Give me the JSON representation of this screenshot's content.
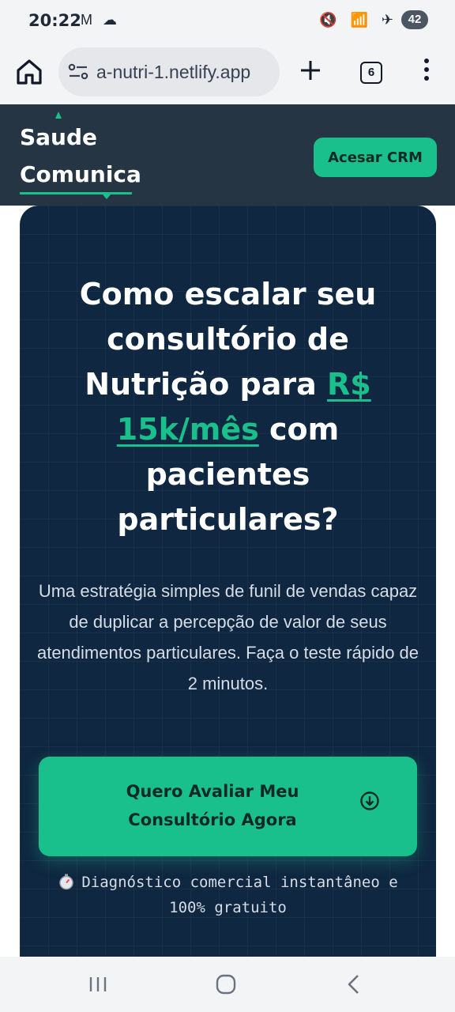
{
  "status_bar": {
    "time": "20:22",
    "left_icons": "M ☁",
    "right_icons": "🔇 📶 ✈",
    "battery": "42"
  },
  "browser": {
    "url": "a-nutri-1.netlify.app",
    "tab_count": "6"
  },
  "header": {
    "brand_line1": "Saude",
    "brand_line2": "Comunica",
    "crm_button": "Acesar CRM",
    "accent_color": "#19c08b"
  },
  "hero": {
    "title_part1": "Como escalar seu consultório de Nutrição para ",
    "title_accent": "R$ 15k/mês",
    "title_part2": " com pacientes particulares?",
    "subtitle": "Uma estratégia simples de funil de vendas capaz de duplicar a percepção de valor de seus atendimentos particulares. Faça o teste rápido de 2 minutos.",
    "cta_label": "Quero Avaliar Meu Consultório Agora",
    "cta_icon": "arrow-down-circle-icon",
    "note": "Diagnóstico comercial instantâneo e 100% gratuito",
    "note_icon": "stopwatch-icon"
  }
}
